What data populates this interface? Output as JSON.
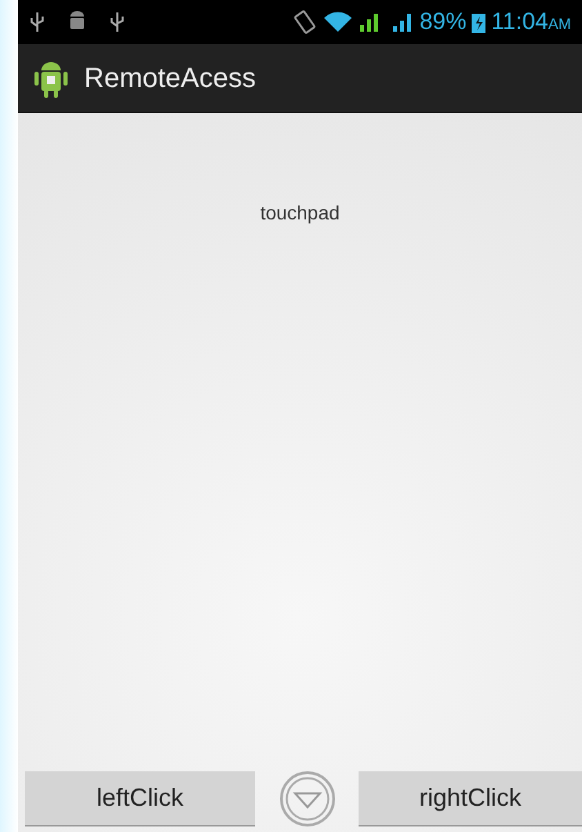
{
  "status_bar": {
    "battery_percent": "89%",
    "time": "11:04",
    "time_suffix": "AM"
  },
  "action_bar": {
    "title": "RemoteAcess"
  },
  "content": {
    "label": "touchpad"
  },
  "buttons": [
    {
      "kind": "button",
      "label": "leftClick"
    },
    {
      "kind": "scroll"
    },
    {
      "kind": "button",
      "label": "rightClick"
    }
  ]
}
